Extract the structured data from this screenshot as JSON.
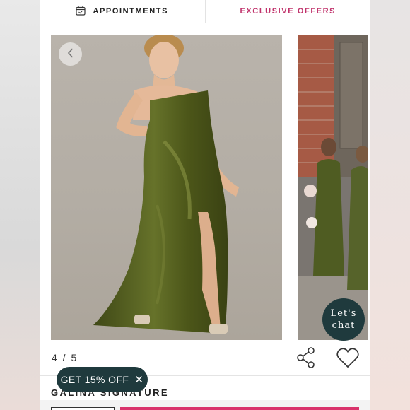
{
  "topbar": {
    "appointments_label": "APPOINTMENTS",
    "appointments_icon": "calendar-icon",
    "offers_label": "EXCLUSIVE OFFERS"
  },
  "gallery": {
    "counter": "4 / 5",
    "prev_icon": "chevron-left-icon"
  },
  "actions": {
    "share_icon": "share-icon",
    "favorite_icon": "heart-icon"
  },
  "product": {
    "name": "GALINA SIGNATURE"
  },
  "promo": {
    "label": "GET 15% OFF",
    "close": "✕"
  },
  "chat": {
    "line1": "Let's",
    "line2": "chat"
  },
  "colors": {
    "accent_pink": "#c0326b",
    "chat_bg": "#1f3a3d",
    "dress_green": "#4f5a1c"
  }
}
